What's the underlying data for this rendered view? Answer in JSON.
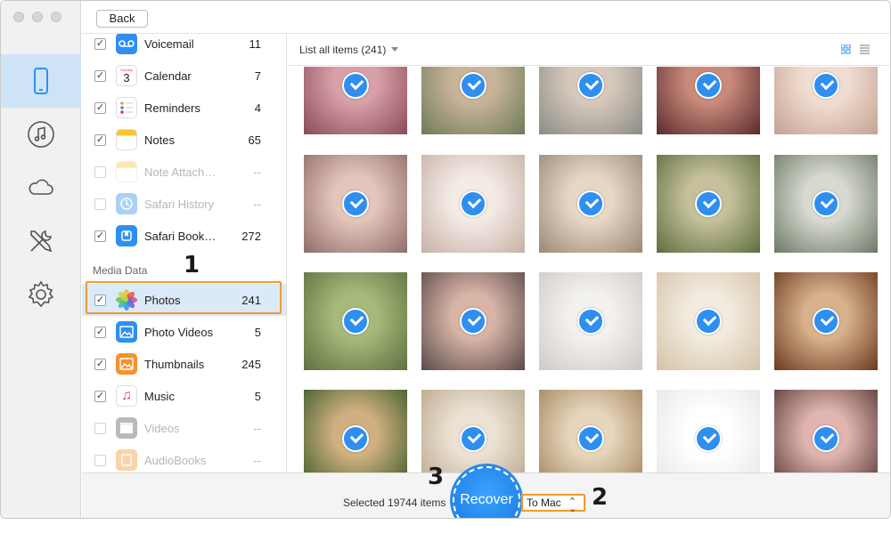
{
  "toolbar": {
    "back_label": "Back"
  },
  "rail": {
    "items": [
      {
        "icon": "phone-icon",
        "active": true
      },
      {
        "icon": "music-icon",
        "active": false
      },
      {
        "icon": "cloud-icon",
        "active": false
      },
      {
        "icon": "tools-icon",
        "active": false
      },
      {
        "icon": "gear-icon",
        "active": false
      }
    ]
  },
  "categories": {
    "items": [
      {
        "label": "Voicemail",
        "count": "11",
        "checked": true,
        "enabled": true,
        "icon": "voicemail-icon"
      },
      {
        "label": "Calendar",
        "count": "7",
        "checked": true,
        "enabled": true,
        "icon": "calendar-icon",
        "icon_text": "Sunday",
        "icon_day": "3"
      },
      {
        "label": "Reminders",
        "count": "4",
        "checked": true,
        "enabled": true,
        "icon": "reminders-icon"
      },
      {
        "label": "Notes",
        "count": "65",
        "checked": true,
        "enabled": true,
        "icon": "notes-icon"
      },
      {
        "label": "Note Attach…",
        "count": "--",
        "checked": false,
        "enabled": false,
        "icon": "note-attachment-icon"
      },
      {
        "label": "Safari History",
        "count": "--",
        "checked": false,
        "enabled": false,
        "icon": "safari-history-icon"
      },
      {
        "label": "Safari Book…",
        "count": "272",
        "checked": true,
        "enabled": true,
        "icon": "safari-bookmark-icon"
      }
    ],
    "media_header": "Media Data",
    "media_items": [
      {
        "label": "Photos",
        "count": "241",
        "checked": true,
        "enabled": true,
        "selected": true,
        "icon": "photos-icon"
      },
      {
        "label": "Photo Videos",
        "count": "5",
        "checked": true,
        "enabled": true,
        "icon": "photo-videos-icon"
      },
      {
        "label": "Thumbnails",
        "count": "245",
        "checked": true,
        "enabled": true,
        "icon": "thumbnails-icon"
      },
      {
        "label": "Music",
        "count": "5",
        "checked": true,
        "enabled": true,
        "icon": "music-note-icon"
      },
      {
        "label": "Videos",
        "count": "--",
        "checked": false,
        "enabled": false,
        "icon": "videos-icon"
      },
      {
        "label": "AudioBooks",
        "count": "--",
        "checked": false,
        "enabled": false,
        "icon": "audiobooks-icon"
      }
    ]
  },
  "grid": {
    "list_label": "List all items (241)",
    "photos_checked": 20
  },
  "footer": {
    "selected_text": "Selected 19744 items",
    "recover_label": "Recover",
    "destination": "To Mac"
  },
  "annotations": {
    "step1": "1",
    "step2": "2",
    "step3": "3"
  },
  "colors": {
    "accent": "#2f8ff0",
    "highlight": "#f39a2b",
    "rail_active": "#cfe3f7"
  }
}
